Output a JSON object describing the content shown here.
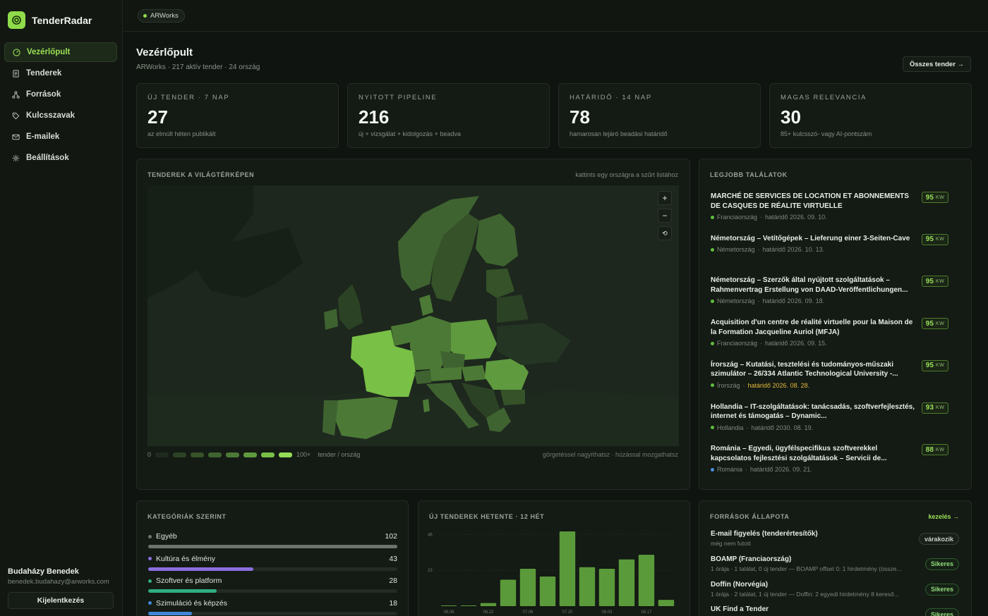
{
  "app": {
    "name": "TenderRadar"
  },
  "sidebar": {
    "items": [
      {
        "label": "Vezérlőpult",
        "icon": "gauge-icon",
        "active": true
      },
      {
        "label": "Tenderek",
        "icon": "document-icon",
        "active": false
      },
      {
        "label": "Források",
        "icon": "network-icon",
        "active": false
      },
      {
        "label": "Kulcsszavak",
        "icon": "tag-icon",
        "active": false
      },
      {
        "label": "E-mailek",
        "icon": "mail-icon",
        "active": false
      },
      {
        "label": "Beállítások",
        "icon": "gear-icon",
        "active": false
      }
    ],
    "user": {
      "name": "Budaházy Benedek",
      "email": "benedek.budahazy@arworks.com"
    },
    "logout_label": "Kijelentkezés"
  },
  "topbar": {
    "org": "ARWorks"
  },
  "header": {
    "title": "Vezérlőpult",
    "subtitle": "ARWorks · 217 aktív tender · 24 ország",
    "all_button": "Összes tender →"
  },
  "stats": [
    {
      "label": "ÚJ TENDER · 7 NAP",
      "value": "27",
      "desc": "az elmúlt héten publikált"
    },
    {
      "label": "NYITOTT PIPELINE",
      "value": "216",
      "desc": "új + vizsgálat + kidolgozás + beadva"
    },
    {
      "label": "HATÁRIDŐ · 14 NAP",
      "value": "78",
      "desc": "hamarosan lejáró beadási határidő"
    },
    {
      "label": "MAGAS RELEVANCIA",
      "value": "30",
      "desc": "85+ kulcsszó- vagy AI-pontszám"
    }
  ],
  "map": {
    "title": "TENDEREK A VILÁGTÉRKÉPEN",
    "hint": "kattints egy országra a szűrt listához",
    "legend_min": "0",
    "legend_max": "100+",
    "legend_unit": "tender / ország",
    "footer": "görgetéssel nagyíthatsz · húzással mozgathatsz",
    "colors": [
      "#1f2a1f",
      "#2c4224",
      "#355228",
      "#3f6330",
      "#4c7a36",
      "#5f9a3e",
      "#79c046",
      "#94dc55"
    ]
  },
  "top_hits": {
    "title": "LEGJOBB TALÁLATOK",
    "kw_label": "KW",
    "items": [
      {
        "title": "MARCHÉ DE SERVICES DE LOCATION ET ABONNEMENTS DE CASQUES DE RÉALITE VIRTUELLE",
        "country": "Franciaország",
        "deadline": "határidő 2026. 09. 10.",
        "score": "95",
        "dot": "#5fbf3f",
        "urgent": false
      },
      {
        "title": "Németország – Vetítőgépek – Lieferung einer 3-Seiten-Cave",
        "country": "Németország",
        "deadline": "határidő 2026. 10. 13.",
        "score": "95",
        "dot": "#5fbf3f",
        "urgent": false
      },
      {
        "title": "Németország – Szerzők által nyújtott szolgáltatások – Rahmenvertrag Erstellung von DAAD-Veröffentlichungen...",
        "country": "Németország",
        "deadline": "határidő 2026. 09. 18.",
        "score": "95",
        "dot": "#5fbf3f",
        "urgent": false
      },
      {
        "title": "Acquisition d'un centre de réalité virtuelle pour la Maison de la Formation Jacqueline Auriol (MFJA)",
        "country": "Franciaország",
        "deadline": "határidő 2026. 09. 15.",
        "score": "95",
        "dot": "#5fbf3f",
        "urgent": false
      },
      {
        "title": "Írország – Kutatási, tesztelési és tudományos-műszaki szimulátor – 26/334 Atlantic Technological University -...",
        "country": "Írország",
        "deadline": "határidő 2026. 08. 28.",
        "score": "95",
        "dot": "#5fbf3f",
        "urgent": true
      },
      {
        "title": "Hollandia – IT-szolgáltatások: tanácsadás, szoftverfejlesztés, internet és támogatás – Dynamic...",
        "country": "Hollandia",
        "deadline": "határidő 2030. 08. 19.",
        "score": "93",
        "dot": "#5fbf3f",
        "urgent": false
      },
      {
        "title": "Románia – Egyedi, ügyfélspecifikus szoftverekkel kapcsolatos fejlesztési szolgáltatások – Servicii de...",
        "country": "Románia",
        "deadline": "határidő 2026. 09. 21.",
        "score": "88",
        "dot": "#4a8fe0",
        "urgent": false
      }
    ]
  },
  "categories": {
    "title": "KATEGÓRIÁK SZERINT",
    "max": 102,
    "items": [
      {
        "name": "Egyéb",
        "count": 102,
        "color": "#6c756c"
      },
      {
        "name": "Kultúra és élmény",
        "count": 43,
        "color": "#8b6fe0"
      },
      {
        "name": "Szoftver és platform",
        "count": 28,
        "color": "#2fae82"
      },
      {
        "name": "Szimuláció és képzés",
        "count": 18,
        "color": "#3f86d8"
      }
    ]
  },
  "weekly": {
    "title": "ÚJ TENDEREK HETENTE · 12 HÉT",
    "chart_data": {
      "type": "bar",
      "categories": [
        "06.08",
        "",
        "06.22",
        "",
        "07.06",
        "",
        "07.20",
        "",
        "08.03",
        "",
        "08.17",
        ""
      ],
      "values": [
        0,
        0,
        2,
        17,
        24,
        19,
        48,
        25,
        24,
        30,
        33,
        4
      ],
      "yticks": [
        "46",
        "23"
      ],
      "ylim": [
        0,
        48
      ]
    }
  },
  "sources": {
    "title": "FORRÁSOK ÁLLAPOTA",
    "manage_label": "kezelés →",
    "items": [
      {
        "name": "E-mail figyelés (tenderértesítők)",
        "desc": "még nem futott",
        "status": "várakozik",
        "ok": false
      },
      {
        "name": "BOAMP (Franciaország)",
        "desc": "1 órája · 1 találat, 0 új tender — BOAMP offset 0: 1 hirdetmény (össze...",
        "status": "Sikeres",
        "ok": true
      },
      {
        "name": "Doffin (Norvégia)",
        "desc": "1 órája · 2 találat, 1 új tender — Doffin: 2 egyedi hirdetmény 8 kereső...",
        "status": "Sikeres",
        "ok": true
      },
      {
        "name": "UK Find a Tender",
        "desc": "",
        "status": "Sikeres",
        "ok": true
      }
    ]
  }
}
